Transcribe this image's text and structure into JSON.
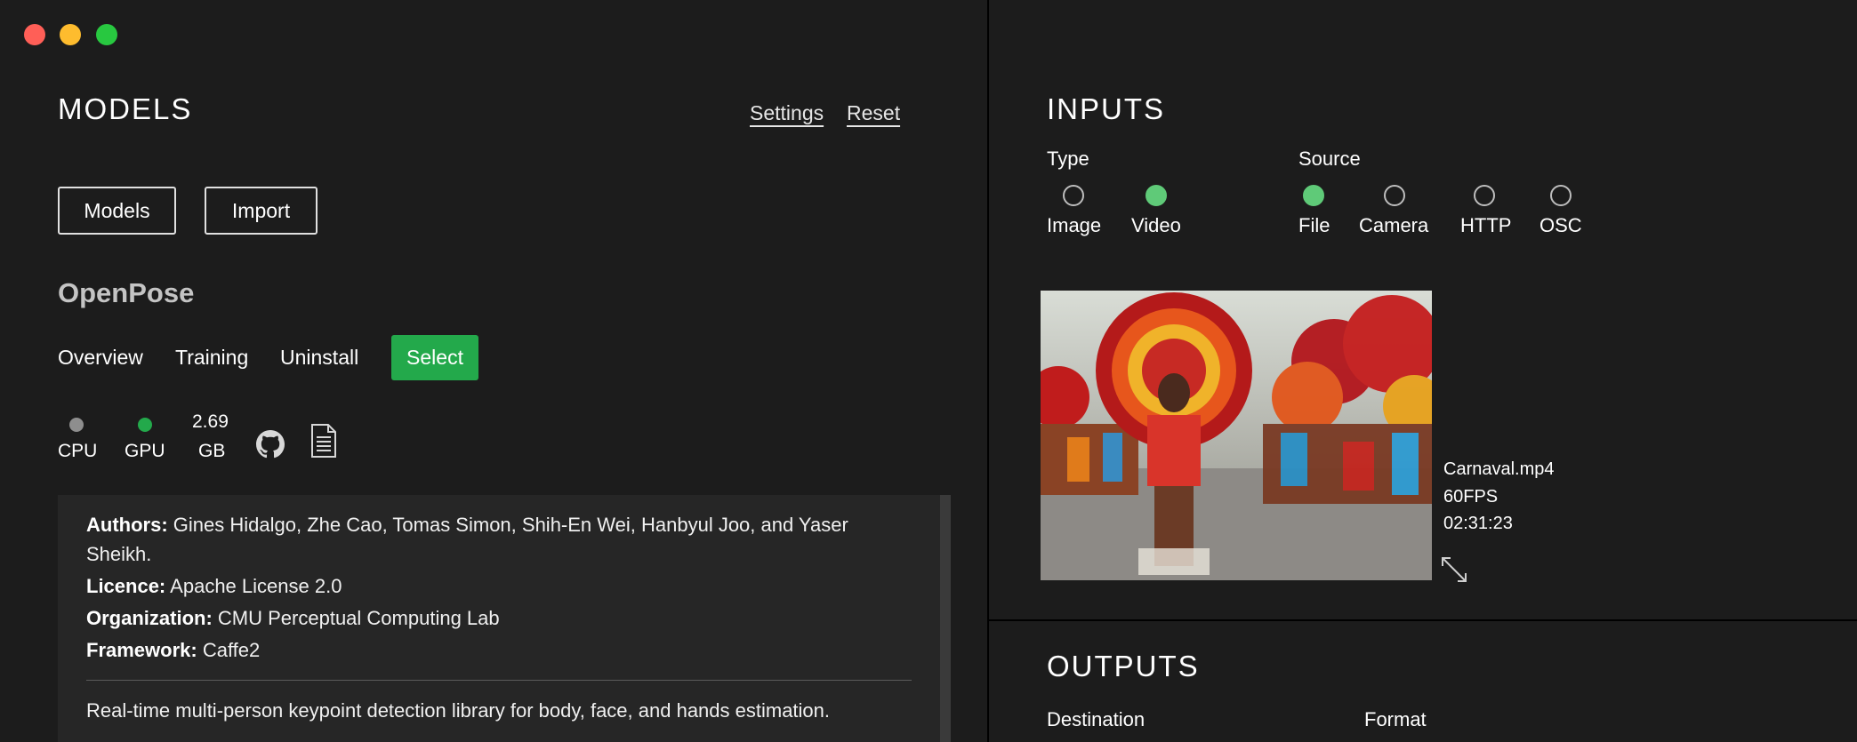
{
  "window": {
    "traffic_lights": [
      "#ff5f57",
      "#febc2e",
      "#28c840"
    ]
  },
  "models_panel": {
    "title": "MODELS",
    "settings_link": "Settings",
    "reset_link": "Reset",
    "models_button": "Models",
    "import_button": "Import",
    "model_name": "OpenPose",
    "tabs": [
      "Overview",
      "Training",
      "Uninstall"
    ],
    "select_button": "Select",
    "hardware": {
      "cpu_label": "CPU",
      "cpu_color": "#8e8e8e",
      "gpu_label": "GPU",
      "gpu_color": "#23a94b",
      "size_value": "2.69",
      "size_unit": "GB"
    },
    "icons": [
      "github-icon",
      "document-icon"
    ],
    "info": {
      "authors_label": "Authors:",
      "authors_value": "Gines Hidalgo, Zhe Cao, Tomas Simon, Shih-En Wei, Hanbyul Joo, and Yaser",
      "authors_value_cont": "Sheikh.",
      "licence_label": "Licence:",
      "licence_value": "Apache License 2.0",
      "organization_label": "Organization:",
      "organization_value": "CMU Perceptual Computing Lab",
      "framework_label": "Framework:",
      "framework_value": "Caffe2",
      "description": "Real-time multi-person keypoint detection library for body, face, and hands estimation."
    }
  },
  "inputs_panel": {
    "title": "INPUTS",
    "type_label": "Type",
    "type_options": [
      {
        "label": "Image",
        "selected": false
      },
      {
        "label": "Video",
        "selected": true
      }
    ],
    "source_label": "Source",
    "source_options": [
      {
        "label": "File",
        "selected": true
      },
      {
        "label": "Camera",
        "selected": false
      },
      {
        "label": "HTTP",
        "selected": false
      },
      {
        "label": "OSC",
        "selected": false
      }
    ],
    "file": {
      "name": "Carnaval.mp4",
      "fps": "60FPS",
      "duration": "02:31:23"
    },
    "accent_color": "#5fca78"
  },
  "outputs_panel": {
    "title": "OUTPUTS",
    "destination_label": "Destination",
    "format_label": "Format"
  }
}
